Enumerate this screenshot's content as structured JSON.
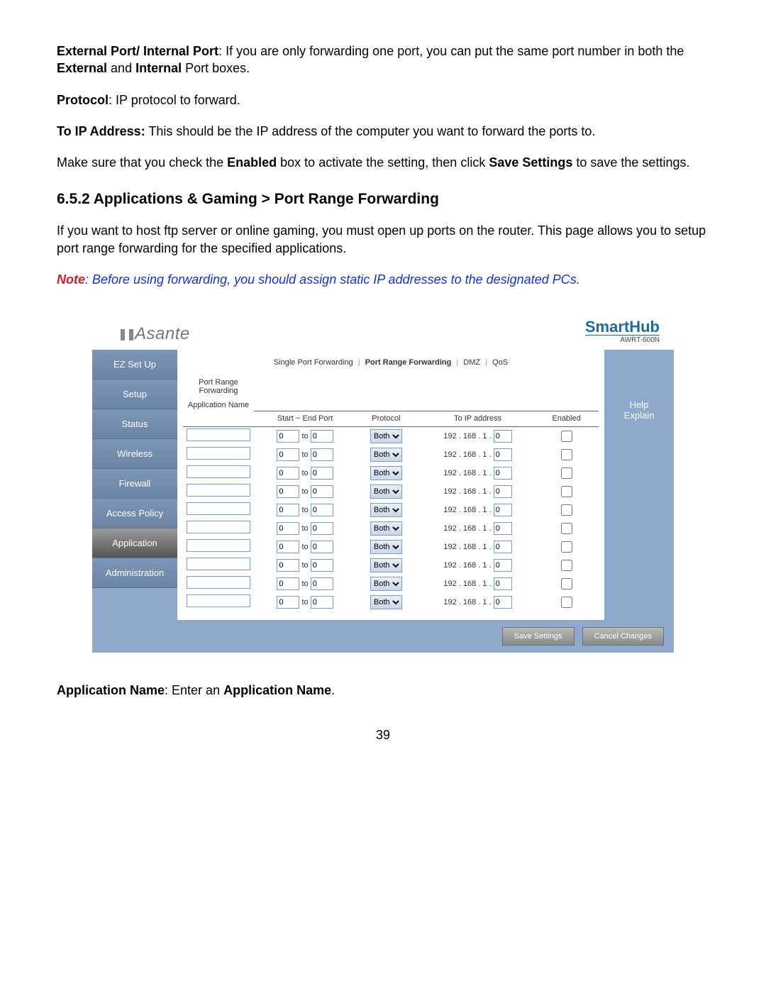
{
  "doc": {
    "p1_bold": "External Port/ Internal Port",
    "p1_rest": ": If you are only forwarding one port, you can put the same port number in both the ",
    "p1_b2": "External",
    "p1_mid": " and ",
    "p1_b3": "Internal",
    "p1_tail": " Port boxes.",
    "p2_bold": "Protocol",
    "p2_rest": ": IP protocol to forward.",
    "p3_bold": "To IP Address:",
    "p3_rest": "  This should be the IP address of the computer you want to forward the ports to.",
    "p4_a": "Make sure that you check the ",
    "p4_b1": "Enabled",
    "p4_b": " box to activate the setting, then click ",
    "p4_b2": "Save Settings",
    "p4_c": " to save the settings.",
    "h_section": "6.5.2 Applications & Gaming > Port Range Forwarding",
    "p5": "If you want to host ftp server or online gaming, you must open up ports on the router. This page allows you to setup port range forwarding for the specified applications.",
    "note_lead": "Note",
    "note_body": ": Before using forwarding, you should assign static IP addresses to the designated PCs.",
    "p6_b": "Application Name",
    "p6_mid": ": Enter an ",
    "p6_b2": "Application Name",
    "p6_tail": ".",
    "page_number": "39"
  },
  "router": {
    "brand_left": "Asante",
    "brand_right": "SmartHub",
    "brand_right_sub": "AWRT-600N",
    "sidebar": [
      "EZ Set Up",
      "Setup",
      "Status",
      "Wireless",
      "Firewall",
      "Access Policy",
      "Application",
      "Administration"
    ],
    "sidebar_active_index": 6,
    "subnav": [
      "Single Port Forwarding",
      "Port Range Forwarding",
      "DMZ",
      "QoS"
    ],
    "subnav_active_index": 1,
    "section_label_1": "Port Range",
    "section_label_2": "Forwarding",
    "col_appname": "Application Name",
    "col_ports": "Start ~ End Port",
    "col_proto": "Protocol",
    "col_ip": "To IP address",
    "col_enabled": "Enabled",
    "to_word": "to",
    "ip_prefix": "192 . 168 . 1 .",
    "proto_default": "Both",
    "port_default": "0",
    "ip_default": "0",
    "row_count_note": "10 rows",
    "help_title": "Help",
    "help_link": "Explain",
    "btn_save": "Save Settings",
    "btn_cancel": "Cancel Changes"
  }
}
